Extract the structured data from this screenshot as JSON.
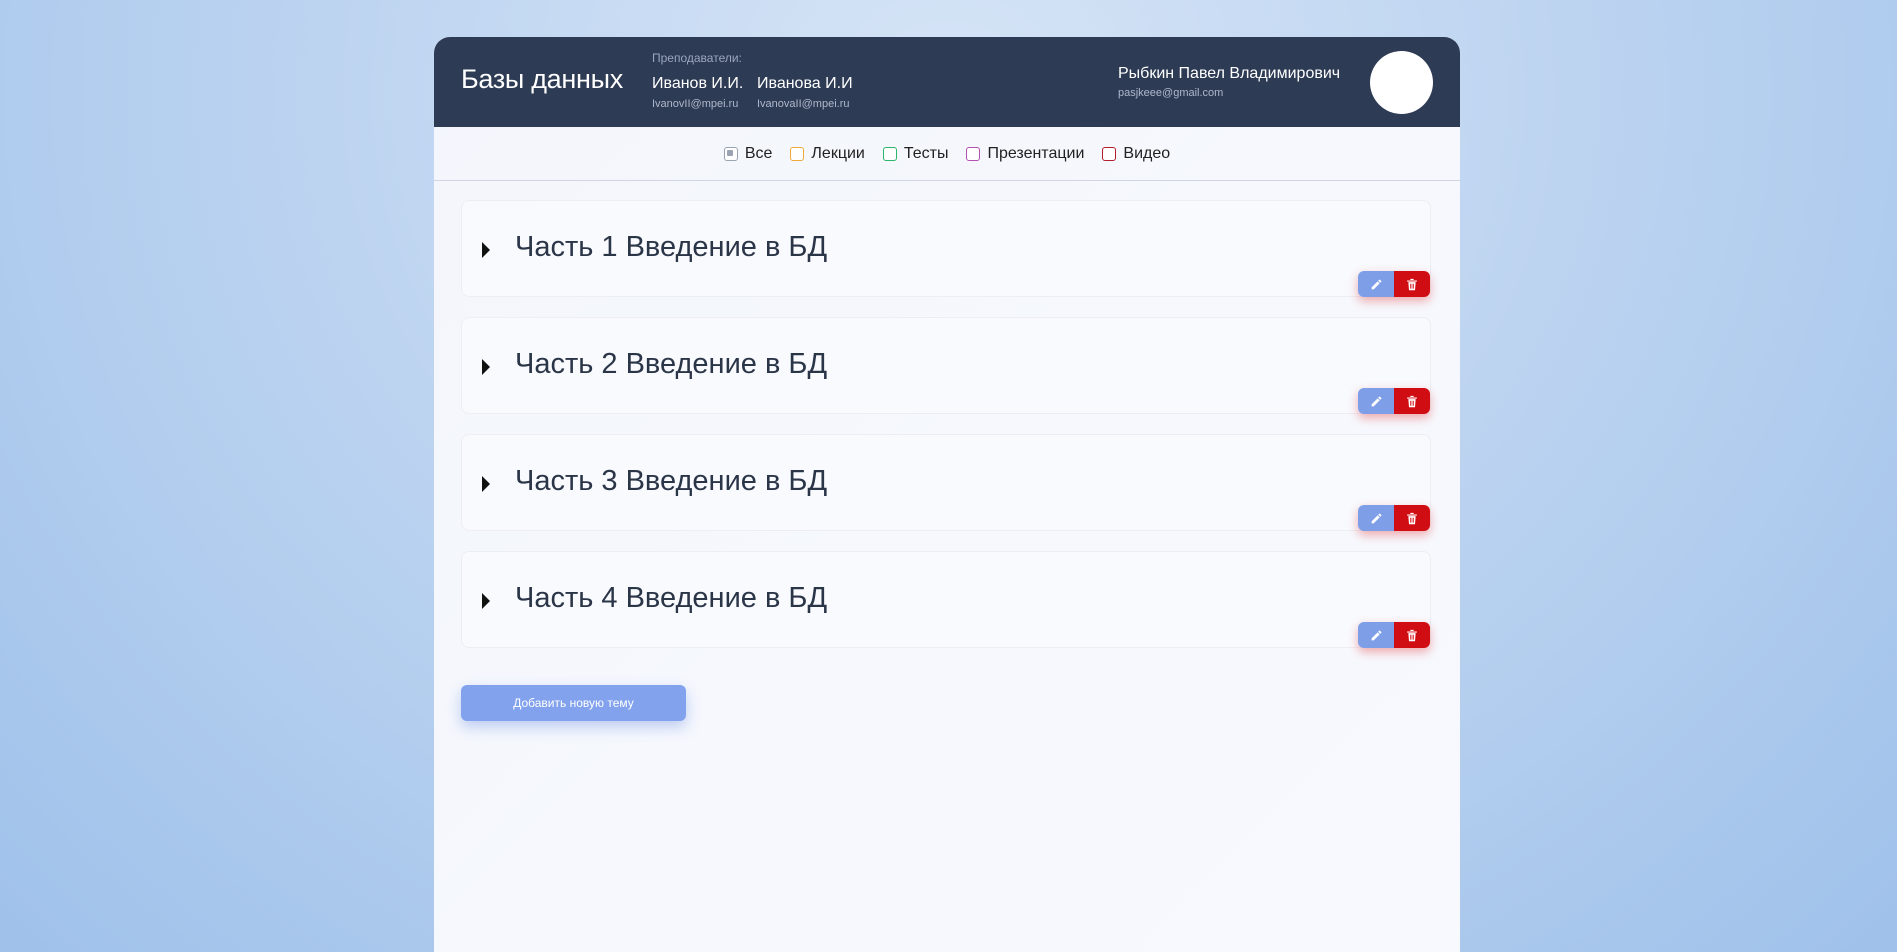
{
  "header": {
    "course_title": "Базы данных",
    "teachers_caption": "Преподаватели:",
    "teachers": [
      {
        "name": "Иванов И.И.",
        "email": "IvanovII@mpei.ru"
      },
      {
        "name": "Иванова И.И",
        "email": "IvanovaII@mpei.ru"
      }
    ],
    "user": {
      "name": "Рыбкин Павел Владимирович",
      "email": "pasjkeee@gmail.com"
    }
  },
  "filters": [
    {
      "label": "Все",
      "checked": true,
      "color": "#9aa3b2"
    },
    {
      "label": "Лекции",
      "checked": false,
      "color": "#f0a93a"
    },
    {
      "label": "Тесты",
      "checked": false,
      "color": "#2bb56a"
    },
    {
      "label": "Презентации",
      "checked": false,
      "color": "#b44fb3"
    },
    {
      "label": "Видео",
      "checked": false,
      "color": "#b31c2a"
    }
  ],
  "topics": [
    {
      "title": "Часть 1 Введение в БД"
    },
    {
      "title": "Часть 2 Введение в БД"
    },
    {
      "title": "Часть 3 Введение в БД"
    },
    {
      "title": "Часть 4 Введение в БД"
    }
  ],
  "actions": {
    "add_topic_label": "Добавить новую тему",
    "edit_icon": "pencil-icon",
    "delete_icon": "trash-icon"
  },
  "colors": {
    "header_bg": "#2e3b55",
    "edit_button": "#7f9ee8",
    "delete_button": "#d10d14",
    "add_button": "#82a2ee"
  }
}
